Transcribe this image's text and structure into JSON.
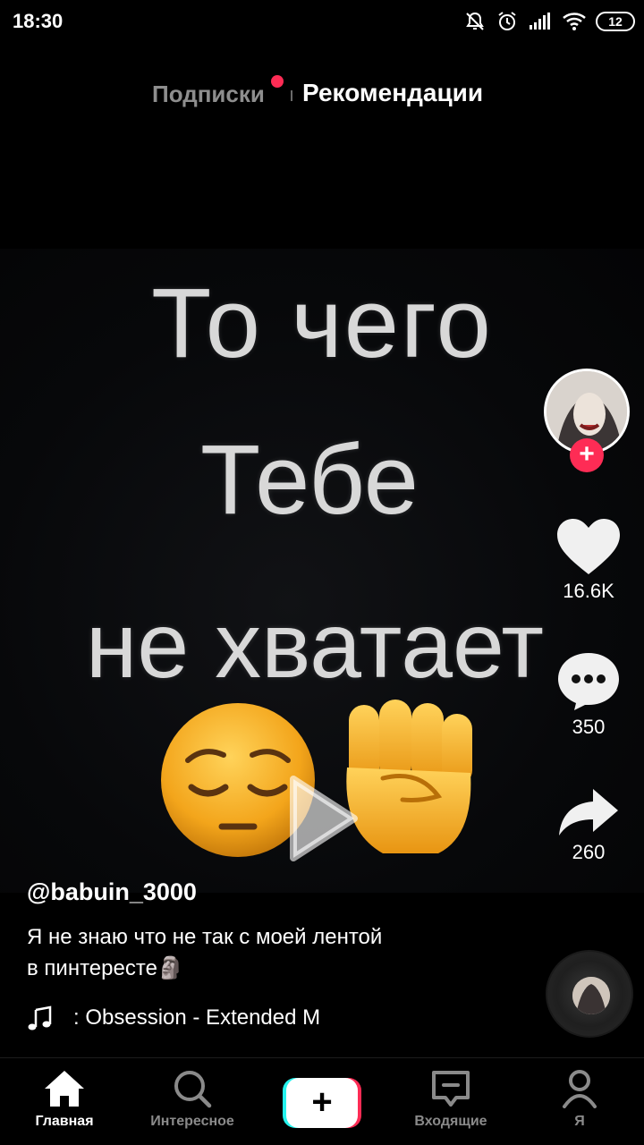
{
  "status_bar": {
    "time": "18:30",
    "battery": "12",
    "icons": [
      "mute-icon",
      "alarm-icon",
      "signal-icon",
      "wifi-icon",
      "battery-icon"
    ]
  },
  "top_tabs": {
    "following": "Подписки",
    "for_you": "Рекомендации",
    "active": "for_you"
  },
  "video": {
    "overlay_lines": [
      "То чего",
      "Тебе",
      "не хватает"
    ],
    "emojis": [
      "pensive-face",
      "raised-fist"
    ]
  },
  "right_rail": {
    "likes": "16.6K",
    "comments": "350",
    "shares": "260",
    "follow_symbol": "+"
  },
  "post": {
    "username": "@babuin_3000",
    "caption_line1": "Я не знаю что не так с моей лентой",
    "caption_line2": "в пинтересте🗿",
    "music_text": ": Obsession - Extended M"
  },
  "bottom_nav": {
    "home": "Главная",
    "discover": "Интересное",
    "create_symbol": "+",
    "inbox": "Входящие",
    "me": "Я"
  },
  "colors": {
    "accent": "#fe2c55",
    "cyan": "#25f4ee",
    "background": "#000000"
  }
}
